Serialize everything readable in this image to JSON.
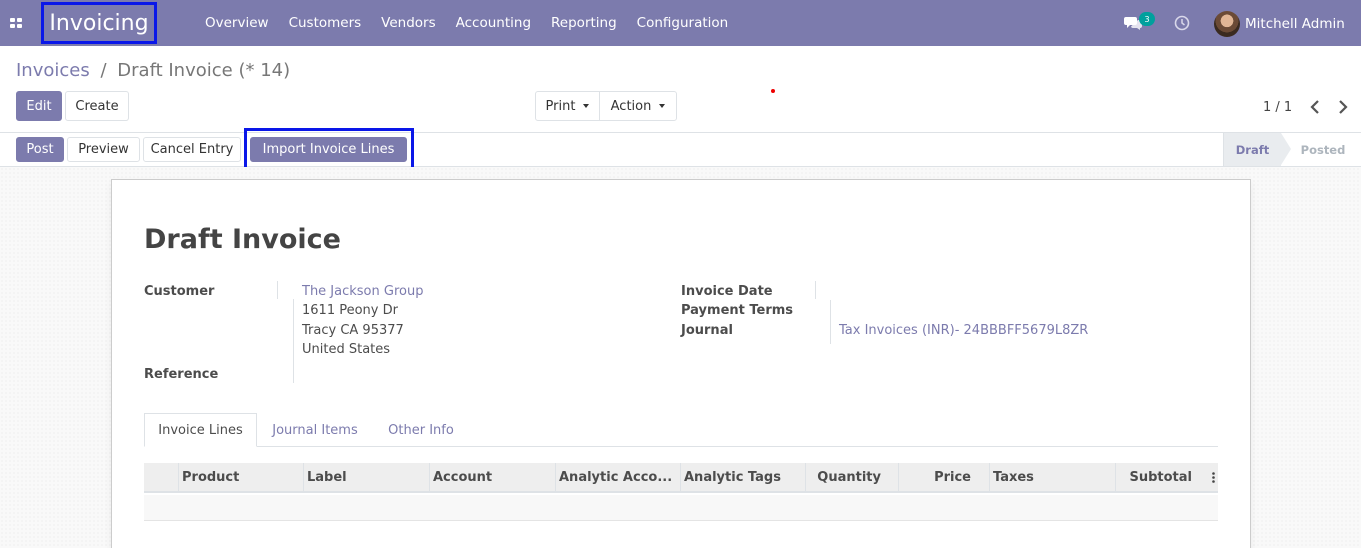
{
  "navbar": {
    "brand": "Invoicing",
    "menu": [
      "Overview",
      "Customers",
      "Vendors",
      "Accounting",
      "Reporting",
      "Configuration"
    ],
    "messages_count": "3",
    "user_name": "Mitchell Admin",
    "accent_color": "#7c7bad"
  },
  "breadcrumb": {
    "parent": "Invoices",
    "separator": "/",
    "current": "Draft Invoice (* 14)"
  },
  "buttons": {
    "edit": "Edit",
    "create": "Create",
    "print": "Print",
    "action": "Action"
  },
  "pager": {
    "value": "1 / 1"
  },
  "statusbar": {
    "post": "Post",
    "preview": "Preview",
    "cancel_entry": "Cancel Entry",
    "import_lines": "Import Invoice Lines",
    "stages": [
      "Draft",
      "Posted"
    ],
    "active_stage": "Draft"
  },
  "form": {
    "title": "Draft Invoice",
    "customer_label": "Customer",
    "customer_name": "The Jackson Group",
    "address": [
      "1611 Peony Dr",
      "Tracy CA 95377",
      "United States"
    ],
    "reference_label": "Reference",
    "invoice_date_label": "Invoice Date",
    "payment_terms_label": "Payment Terms",
    "journal_label": "Journal",
    "journal_value": "Tax Invoices (INR)- 24BBBFF5679L8ZR"
  },
  "tabs": [
    "Invoice Lines",
    "Journal Items",
    "Other Info"
  ],
  "table": {
    "columns": [
      "Product",
      "Label",
      "Account",
      "Analytic Acco...",
      "Analytic Tags",
      "Quantity",
      "Price",
      "Taxes",
      "Subtotal"
    ]
  },
  "icons": {
    "apps": "apps-grid-icon",
    "messages": "chat-icon",
    "activities": "clock-icon",
    "pager_prev": "chevron-left-icon",
    "pager_next": "chevron-right-icon",
    "column_options": "kebab-icon"
  }
}
